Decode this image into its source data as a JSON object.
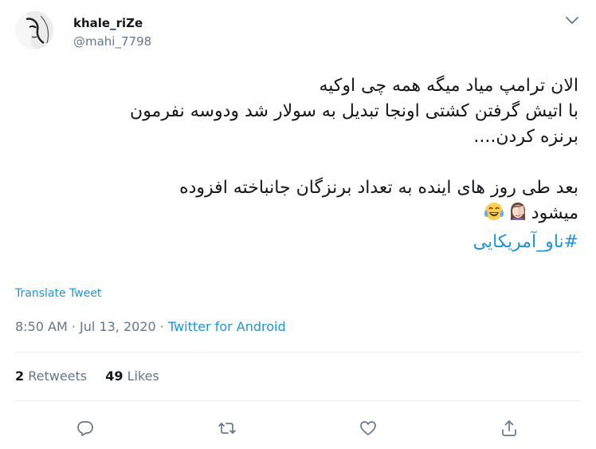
{
  "user": {
    "display_name": "khale_riZe",
    "handle": "@mahi_7798"
  },
  "tweet": {
    "lines": [
      "الان ترامپ میاد میگه همه چی اوکیه",
      "با اتیش گرفتن کشتی اونجا تبدیل به سولار شد ودوسه نفرمون",
      "برنزه کردن....",
      "بعد طی روز های اینده به تعداد برنزگان جانباخته افزوده",
      "میشود"
    ],
    "emojis": [
      "woman-facepalming-emoji",
      "tears-of-joy-emoji"
    ],
    "hashtag": "#ناو_آمریکایی"
  },
  "translate_label": "Translate Tweet",
  "meta": {
    "time": "8:50 AM",
    "separator1": "·",
    "date": "Jul 13, 2020",
    "separator2": "·",
    "source": "Twitter for Android"
  },
  "stats": {
    "retweets_count": "2",
    "retweets_label": "Retweets",
    "likes_count": "49",
    "likes_label": "Likes"
  },
  "icons": [
    "reply-icon",
    "retweet-icon",
    "like-icon",
    "share-icon",
    "chevron-down-icon"
  ],
  "colors": {
    "accent": "#1b95e0",
    "muted": "#657786",
    "text": "#14171a",
    "divider": "#e6ecf0"
  }
}
